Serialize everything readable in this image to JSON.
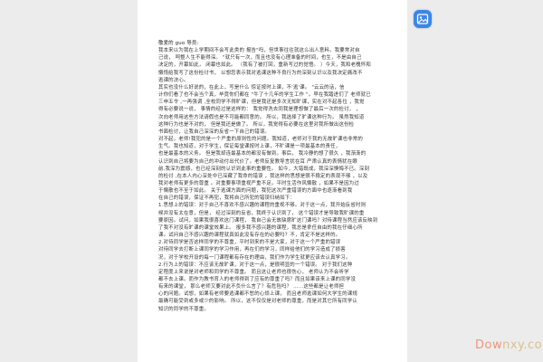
{
  "badge": {
    "label": "图"
  },
  "watermark": {
    "text_a": "Dow",
    "text_b": "nxy.com"
  },
  "lines": [
    "敬爱的 guo 导员:",
    "我本来以为我在上学期间不会写此类的    报告\"吗，但世事往往就这么出人意料。我要常对自",
    "己说，  呵整人生不能得深。  \"就只有一次，而且也没有心理准备的时间，也生，不是由自己",
    "决定的，开幕如此，  闭幕也如此。  （我有了被打回，重新写过的觉悟。  ）今天，我和老槐怀和",
    "懒惰给我写了这份检讨书，    以想您表示我对逃课这种不良行为的深刻认识以及我决定痛改不",
    "逃课的决心。",
    "其实也没什么好说的，在此上，写是什么    惊证按时上课，不'逃'课。    \"云云的话，信",
    "计你们看了也不会当个真，毕竟你们都在  \"牛了十几年的学生工作  \"。早在我踏进们了   老师就已",
    "三申五令 ,一再强调 ,全校同学不得旷课，但是我还是多次无知旷课，实在对不起各位  ，我觉",
    "得有必要说一说，  事情的经过是这样的：  我觉得洗去同我是理想做了最后一次的检讨，  ，",
    "次向老师用这些方法请假也是不可能都同意的。    所以，我选择了旷课这种行为。  虽然我知道",
    "这种行为也是不对的，  但是我还是做了。  所以，我觉得有必要在这里对我所做出这份检",
    "书面检讨，让我自己深深的反省一下自己的错误。",
    "对不起，老师!我犯的是一个严重的原则性的问题。我知道，老师对于我的无故旷课也非常的",
    "生气。我也知道，对于学生，保证每堂课按时上课，不旷课是一项最基本的责任，",
    "也是最基本的义务。  但是我却连最基本的都没有做到。事后，    我冷静的想了很久  ，我渐渐的",
    "认识到自己将要为自己的冲动付出代价了。老师反复教导言犹在耳        严肃认真的表情犹在眼",
    "前,我深为震撼，也已经深刻的认识到此事的重要性。  如今，大错既成，我深深懊悔不已。深刻",
    "的检讨 ,在本人内心深处中已深藏了我命的错误        ，我这样的思想是很不稳定的表现不够    ，以及",
    "我对老师有更多的尊重    。对重要事项重视严重不足。平时生活作风懒散    ，如果不是因为过",
    "于懒散也不至于如此。  关于逃课方面的问题，我犯这次严重错误的方面中也逐渐看到我",
    "在自己的错误，保证不再犯，我将自己所犯的错误归纳如下：",
    "1.思想上的错误：对于自己不喜欢不感兴趣的课程的重视不够。对于这一点，我开始反省时则",
    "候并没有太在意，但是，  经过深刻的反省，我终于认识到了，  这个错误才是导致我旷课的重",
    "要原因。试问，如果我很喜欢这门课程，  我自己会无故缺席旷这门课吗？对待课程当然应该反映到",
    "了我不对没有旷课的课堂效果上。    报多我不感兴趣的课程，我总是拿任自由的我在仔细心所",
    "课。试问自己不感兴趣的课程就真如此没有存在的必要吗？不，肯定不是这样的。",
    "2.对待同学是否这样同学的不尊重，平时到来的不是大家，对于这一个严重的错误",
    "对待同学去打断上课同学的学习作用，再在们的学习，同样给他们的学习造成了损害",
    "况，对于学校开设的每一门课程都有存在的理由，我们作为学生就更应该去认真学习。",
    "2.行为上的错误：不应该无故旷课，对于这一点，是很明显的一个错误。  对于我们这种",
    "定程度上来说是对老师和同学的不尊重。  而且这让老师也很伤心，  老师认为不会听学",
    "都不去上课。而作为教书育人的老师得到了应有的尊重了吗？而且如果该来上课的同学没",
    "有来的课堂，  那么老师又要对此不负什么言了？有危险吗？    ……这些都是让老师担",
    "心的问题。试想，如果有老师要逃课都不愁的心烦上课，  而且老师逃课如何大学生的课规",
    "最确可能受到或多或少的影响。    所以，这不仅仅是对老师的尊重，而是对其它所有同学认",
    "知识的同学的不尊重。"
  ]
}
